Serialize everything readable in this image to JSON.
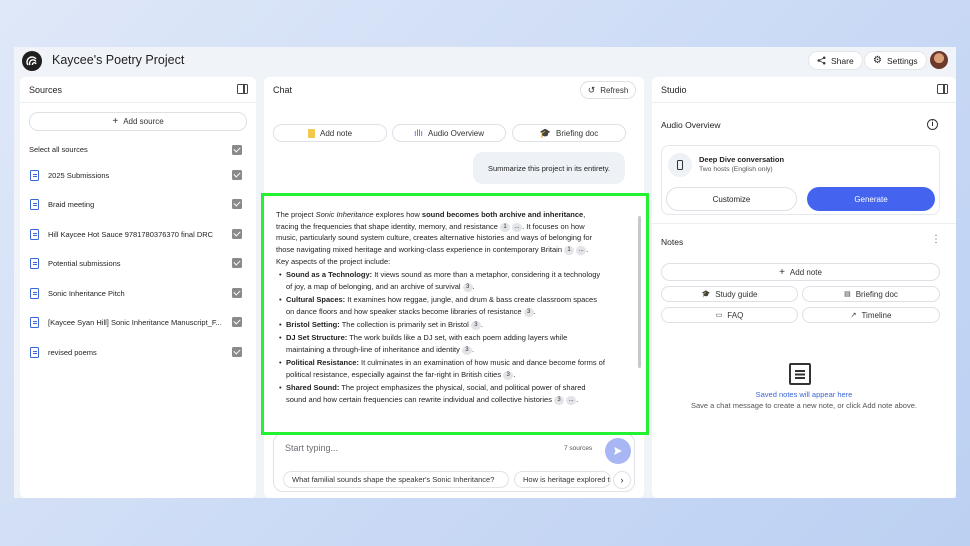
{
  "app": {
    "title": "Kaycee's Poetry Project",
    "share_label": "Share",
    "settings_label": "Settings"
  },
  "sources": {
    "title": "Sources",
    "add_label": "Add source",
    "select_all_label": "Select all sources",
    "items": [
      "2025 Submissions",
      "Braid meeting",
      "Hill Kaycee Hot Sauce 9781780376370 final DRC",
      "Potential submissions",
      "Sonic Inheritance Pitch",
      "[Kaycee Syan Hill] Sonic Inheritance Manuscript_F...",
      "revised poems"
    ]
  },
  "chat": {
    "title": "Chat",
    "refresh_label": "Refresh",
    "actions": {
      "add_note": "Add note",
      "audio_overview": "Audio Overview",
      "briefing_doc": "Briefing doc"
    },
    "user_message": "Summarize this project in its entirety.",
    "answer": {
      "intro_1": "The project ",
      "intro_em": "Sonic Inheritance",
      "intro_2": " explores how ",
      "intro_strong": "sound becomes both archive and inheritance",
      "intro_3": ", tracing the frequencies that shape identity, memory, and resistance ",
      "intro_4": ". It focuses on how music, particularly sound system culture, creates alternative histories and ways of belonging for those navigating mixed heritage and working-class experience in contemporary Britain ",
      "aspects_heading": "Key aspects of the project include:",
      "bullets": [
        {
          "title": "Sound as a Technology:",
          "text": " It views sound as more than a metaphor, considering it a technology of joy, a map of belonging, and an archive of survival ",
          "cite": "3"
        },
        {
          "title": "Cultural Spaces:",
          "text": " It examines how reggae, jungle, and drum & bass create classroom spaces on dance floors and how speaker stacks become libraries of resistance ",
          "cite": "3"
        },
        {
          "title": "Bristol Setting:",
          "text": " The collection is primarily set in Bristol ",
          "cite": "3"
        },
        {
          "title": "DJ Set Structure:",
          "text": " The work builds like a DJ set, with each poem adding layers while maintaining a through-line of inheritance and identity ",
          "cite": "3"
        },
        {
          "title": "Political Resistance:",
          "text": " It culminates in an examination of how music and dance become forms of political resistance, especially against the far-right in British cities ",
          "cite": "3"
        },
        {
          "title": "Shared Sound:",
          "text": " The project emphasizes the physical, social, and political power of shared sound and how certain frequencies can rewrite individual and collective histories",
          "cite": "3"
        }
      ],
      "cite_1": "1",
      "cite_more": "..."
    },
    "input_placeholder": "Start typing...",
    "sources_count": "7 sources",
    "suggestions": [
      "What familial sounds shape the speaker's Sonic Inheritance?",
      "How is heritage explored through sound?"
    ]
  },
  "studio": {
    "title": "Studio",
    "audio_overview_title": "Audio Overview",
    "deep_dive_title": "Deep Dive conversation",
    "deep_dive_sub": "Two hosts (English only)",
    "customize_label": "Customize",
    "generate_label": "Generate",
    "notes_title": "Notes",
    "add_note_label": "Add note",
    "note_actions": [
      "Study guide",
      "Briefing doc",
      "FAQ",
      "Timeline"
    ],
    "empty_title": "Saved notes will appear here",
    "empty_sub": "Save a chat message to create a new note, or click Add note above."
  },
  "colors": {
    "highlight": "#22f232",
    "accent": "#4464f0",
    "doc_icon": "#3b66d6"
  }
}
